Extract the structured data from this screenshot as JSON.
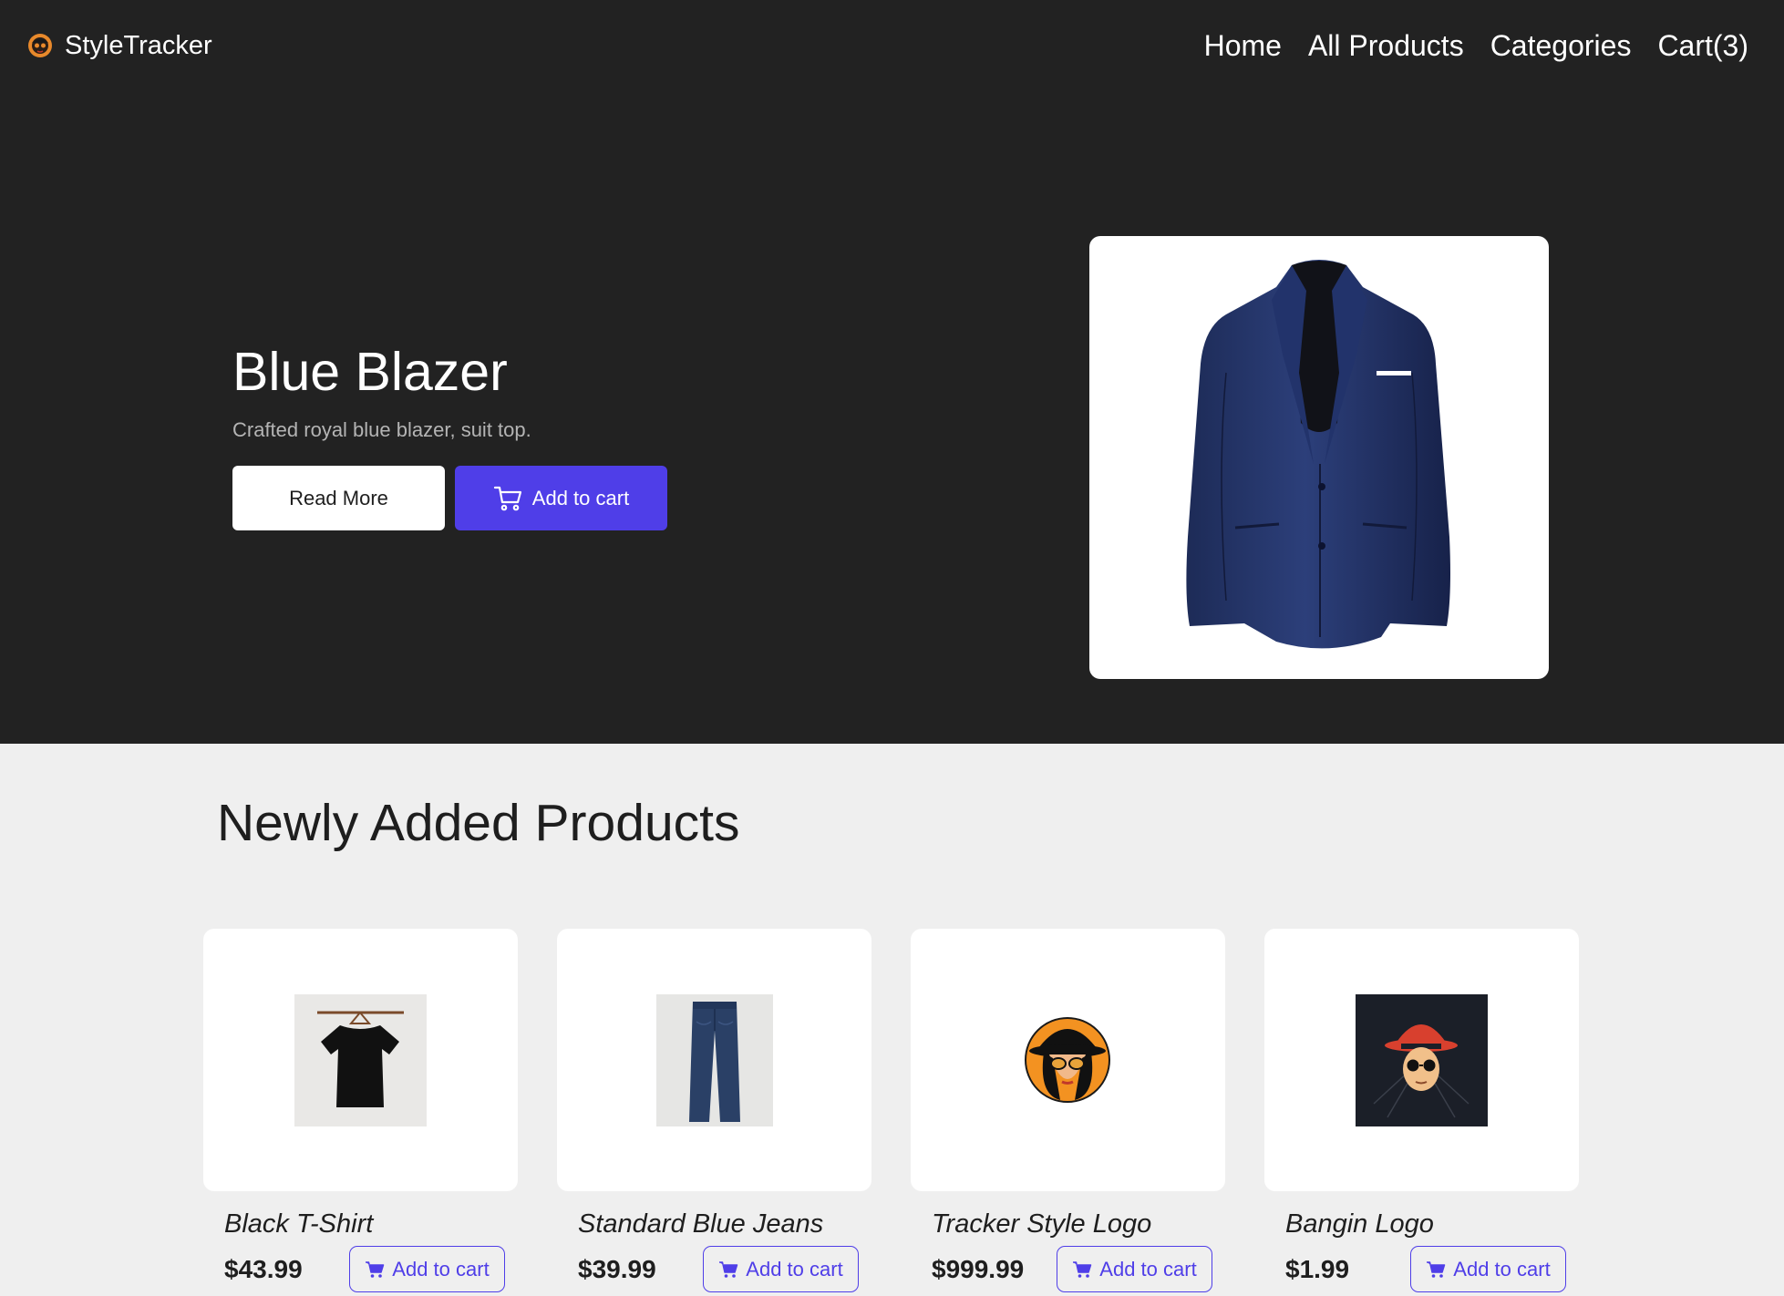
{
  "nav": {
    "brand": "StyleTracker",
    "links": [
      "Home",
      "All Products",
      "Categories",
      "Cart(3)"
    ]
  },
  "hero": {
    "title": "Blue Blazer",
    "description": "Crafted royal blue blazer, suit top.",
    "read_more_label": "Read More",
    "add_to_cart_label": "Add to cart",
    "image": "blue-blazer-image"
  },
  "products_section": {
    "title": "Newly Added Products",
    "products": [
      {
        "name": "Black T-Shirt",
        "price": "$43.99",
        "button_label": "Add to cart",
        "image": "black-tshirt-image"
      },
      {
        "name": "Standard Blue Jeans",
        "price": "$39.99",
        "button_label": "Add to cart",
        "image": "blue-jeans-image"
      },
      {
        "name": "Tracker Style Logo",
        "price": "$999.99",
        "button_label": "Add to cart",
        "image": "tracker-style-logo-image"
      },
      {
        "name": "Bangin Logo",
        "price": "$1.99",
        "button_label": "Add to cart",
        "image": "bangin-logo-image"
      }
    ]
  },
  "colors": {
    "header_bg": "#222222",
    "page_bg": "#efefef",
    "accent": "#4f3ee8"
  },
  "icons": {
    "cart": "cart-icon",
    "brand": "brand-logo-icon"
  }
}
